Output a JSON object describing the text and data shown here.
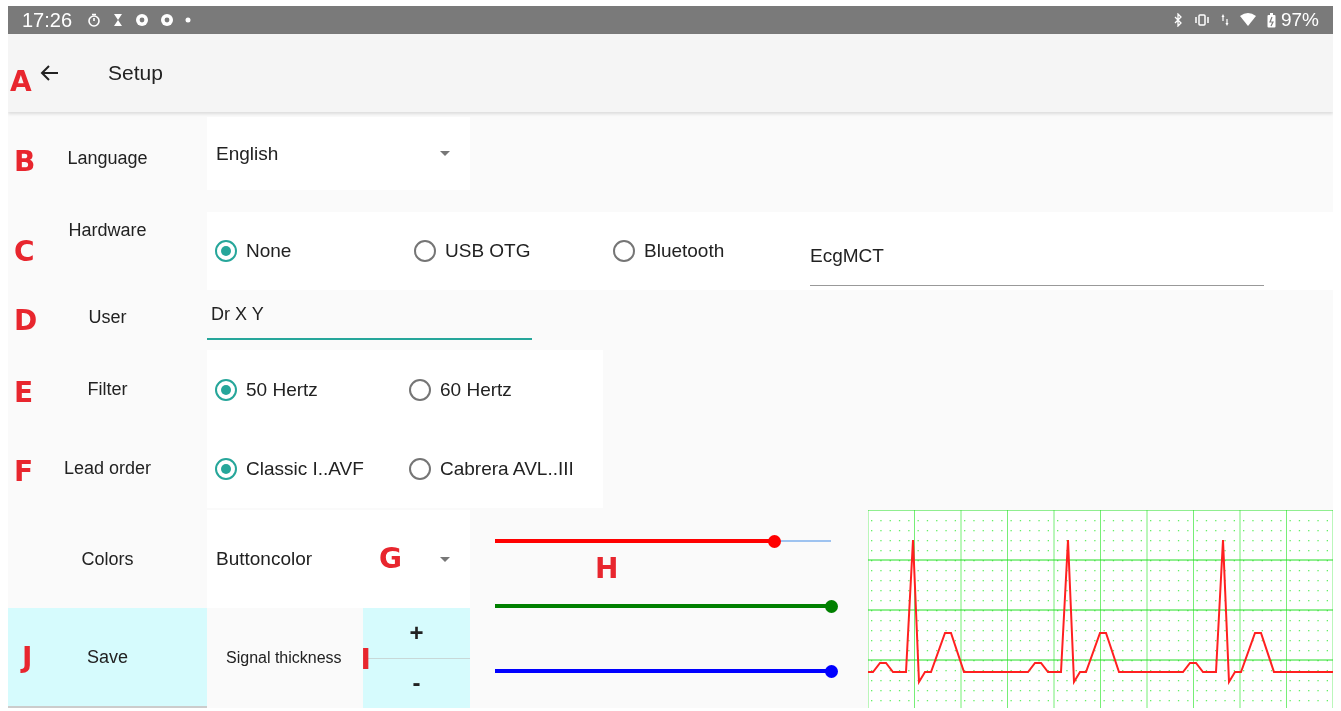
{
  "status_bar": {
    "time": "17:26",
    "battery": "97%"
  },
  "app_bar": {
    "marker": "A",
    "title": "Setup"
  },
  "language": {
    "marker": "B",
    "label": "Language",
    "value": "English"
  },
  "hardware": {
    "marker": "C",
    "label": "Hardware",
    "options": [
      {
        "label": "None",
        "selected": true
      },
      {
        "label": "USB OTG",
        "selected": false
      },
      {
        "label": "Bluetooth",
        "selected": false
      }
    ],
    "device_name": "EcgMCT"
  },
  "user": {
    "marker": "D",
    "label": "User",
    "value": "Dr X Y"
  },
  "filter": {
    "marker": "E",
    "label": "Filter",
    "options": [
      {
        "label": "50 Hertz",
        "selected": true
      },
      {
        "label": "60 Hertz",
        "selected": false
      }
    ]
  },
  "lead_order": {
    "marker": "F",
    "label": "Lead order",
    "options": [
      {
        "label": "Classic I..AVF",
        "selected": true
      },
      {
        "label": "Cabrera AVL..III",
        "selected": false
      }
    ]
  },
  "colors": {
    "label": "Colors",
    "dropdown": {
      "value": "Buttoncolor",
      "marker": "G"
    },
    "sliders_marker": "H",
    "sliders": [
      {
        "color": "#ff0000",
        "level": 0.83
      },
      {
        "color": "#008000",
        "level": 1
      },
      {
        "color": "#0000ff",
        "level": 1
      }
    ]
  },
  "save_button": {
    "label": "Save",
    "marker": "J"
  },
  "signal_thickness": {
    "label": "Signal thickness",
    "marker": "I",
    "increase": "+",
    "decrease": "-"
  }
}
